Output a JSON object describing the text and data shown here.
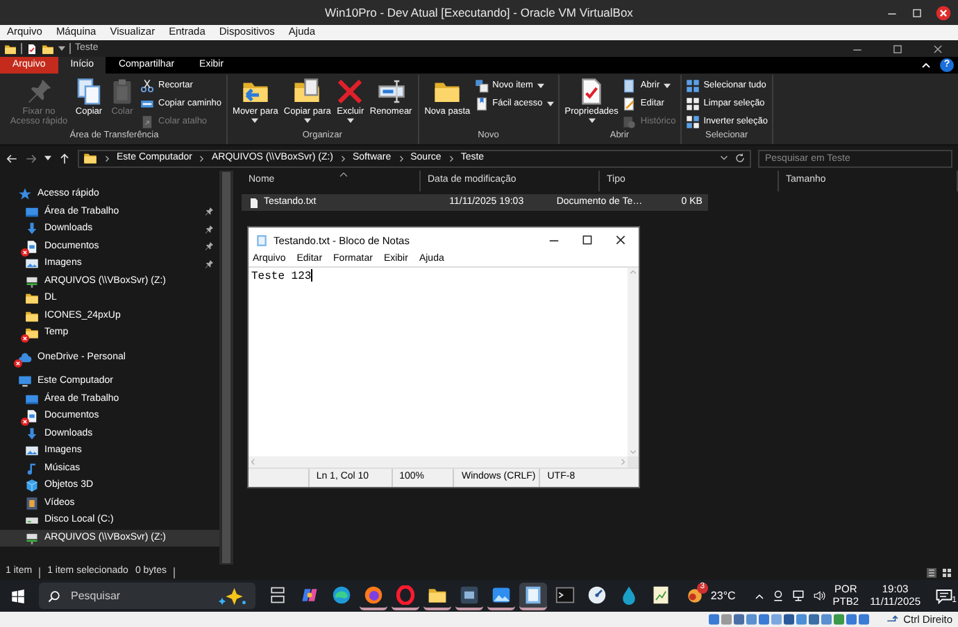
{
  "vbox_window": {
    "title": "Win10Pro - Dev Atual [Executando] - Oracle VM VirtualBox"
  },
  "vbox_menu": [
    "Arquivo",
    "Máquina",
    "Visualizar",
    "Entrada",
    "Dispositivos",
    "Ajuda"
  ],
  "explorer": {
    "title": "Teste",
    "ribbon_tabs": [
      {
        "label": "Arquivo",
        "kind": "file",
        "selected": false
      },
      {
        "label": "Início",
        "kind": "tab",
        "selected": true
      },
      {
        "label": "Compartilhar",
        "kind": "tab",
        "selected": false
      },
      {
        "label": "Exibir",
        "kind": "tab",
        "selected": false
      }
    ],
    "help_button": "?",
    "ribbon_groups": [
      {
        "label": "Área de Transferência",
        "items": [
          {
            "label": "Fixar no Acesso rápido",
            "kind": "large",
            "disabled": true,
            "dropdown": false
          },
          {
            "label": "Copiar",
            "kind": "large",
            "disabled": false,
            "dropdown": false
          },
          {
            "label": "Colar",
            "kind": "large",
            "disabled": true,
            "dropdown": false
          },
          {
            "label": "Recortar",
            "kind": "small",
            "disabled": false,
            "dropdown": false
          },
          {
            "label": "Copiar caminho",
            "kind": "small",
            "disabled": false,
            "dropdown": false
          },
          {
            "label": "Colar atalho",
            "kind": "small",
            "disabled": true,
            "dropdown": false
          }
        ]
      },
      {
        "label": "Organizar",
        "items": [
          {
            "label": "Mover para",
            "kind": "large",
            "disabled": false,
            "dropdown": true
          },
          {
            "label": "Copiar para",
            "kind": "large",
            "disabled": false,
            "dropdown": true
          },
          {
            "label": "Excluir",
            "kind": "large",
            "disabled": false,
            "dropdown": true
          },
          {
            "label": "Renomear",
            "kind": "large",
            "disabled": false,
            "dropdown": false
          }
        ]
      },
      {
        "label": "Novo",
        "items": [
          {
            "label": "Nova pasta",
            "kind": "large",
            "disabled": false,
            "dropdown": false
          },
          {
            "label": "Novo item",
            "kind": "small",
            "disabled": false,
            "dropdown": true
          },
          {
            "label": "Fácil acesso",
            "kind": "small",
            "disabled": false,
            "dropdown": true
          }
        ]
      },
      {
        "label": "Abrir",
        "items": [
          {
            "label": "Propriedades",
            "kind": "large",
            "disabled": false,
            "dropdown": true
          },
          {
            "label": "Abrir",
            "kind": "small",
            "disabled": false,
            "dropdown": true
          },
          {
            "label": "Editar",
            "kind": "small",
            "disabled": false,
            "dropdown": false
          },
          {
            "label": "Histórico",
            "kind": "small",
            "disabled": true,
            "dropdown": false
          }
        ]
      },
      {
        "label": "Selecionar",
        "items": [
          {
            "label": "Selecionar tudo",
            "kind": "small",
            "disabled": false,
            "dropdown": false
          },
          {
            "label": "Limpar seleção",
            "kind": "small",
            "disabled": false,
            "dropdown": false
          },
          {
            "label": "Inverter seleção",
            "kind": "small",
            "disabled": false,
            "dropdown": false
          }
        ]
      }
    ],
    "address_path": [
      "Este Computador",
      "ARQUIVOS (\\\\VBoxSvr) (Z:)",
      "Software",
      "Source",
      "Teste"
    ],
    "search": {
      "placeholder": "Pesquisar em Teste"
    },
    "sidebar": [
      {
        "label": "Acesso rápido",
        "kind": "star",
        "selected": false,
        "sync_error": false,
        "children": [
          {
            "label": "Área de Trabalho",
            "kind": "desktop",
            "selected": false,
            "sync_error": false,
            "pinned": true
          },
          {
            "label": "Downloads",
            "kind": "download",
            "selected": false,
            "sync_error": false,
            "pinned": true
          },
          {
            "label": "Documentos",
            "kind": "documents",
            "selected": false,
            "sync_error": true,
            "pinned": true
          },
          {
            "label": "Imagens",
            "kind": "pictures",
            "selected": false,
            "sync_error": false,
            "pinned": true
          },
          {
            "label": "ARQUIVOS (\\\\VBoxSvr) (Z:)",
            "kind": "netdrive",
            "selected": false,
            "sync_error": false,
            "pinned": false
          },
          {
            "label": "DL",
            "kind": "folder",
            "selected": false,
            "sync_error": false,
            "pinned": false
          },
          {
            "label": "ICONES_24pxUp",
            "kind": "folder",
            "selected": false,
            "sync_error": false,
            "pinned": false
          },
          {
            "label": "Temp",
            "kind": "folder",
            "selected": false,
            "sync_error": true,
            "pinned": false
          }
        ]
      },
      {
        "label": "OneDrive - Personal",
        "kind": "cloud",
        "selected": false,
        "sync_error": true
      },
      {
        "label": "Este Computador",
        "kind": "computer",
        "selected": false,
        "sync_error": false,
        "children": [
          {
            "label": "Área de Trabalho",
            "kind": "desktop",
            "selected": false,
            "sync_error": false
          },
          {
            "label": "Documentos",
            "kind": "documents",
            "selected": false,
            "sync_error": true
          },
          {
            "label": "Downloads",
            "kind": "download",
            "selected": false,
            "sync_error": false
          },
          {
            "label": "Imagens",
            "kind": "pictures",
            "selected": false,
            "sync_error": false
          },
          {
            "label": "Músicas",
            "kind": "music",
            "selected": false,
            "sync_error": false
          },
          {
            "label": "Objetos 3D",
            "kind": "objects3d",
            "selected": false,
            "sync_error": false
          },
          {
            "label": "Vídeos",
            "kind": "videos",
            "selected": false,
            "sync_error": false
          },
          {
            "label": "Disco Local (C:)",
            "kind": "disk",
            "selected": false,
            "sync_error": false
          },
          {
            "label": "ARQUIVOS (\\\\VBoxSvr) (Z:)",
            "kind": "netdrive",
            "selected": true,
            "sync_error": false
          }
        ]
      }
    ],
    "file_table": {
      "columns": [
        "Nome",
        "Data de modificação",
        "Tipo",
        "Tamanho"
      ],
      "rows": [
        {
          "cells": [
            "Testando.txt",
            "11/11/2025 19:03",
            "Documento de Te…",
            "0 KB"
          ],
          "selected": true
        }
      ]
    },
    "status_bar": [
      "1 item",
      "1 item selecionado",
      "0 bytes"
    ]
  },
  "notepad": {
    "title": "Testando.txt - Bloco de Notas",
    "menu": [
      "Arquivo",
      "Editar",
      "Formatar",
      "Exibir",
      "Ajuda"
    ],
    "content": "Teste 123",
    "status_bar": [
      "Ln 1, Col 10",
      "100%",
      "Windows (CRLF)",
      "UTF-8"
    ]
  },
  "taskbar": {
    "search_placeholder": "Pesquisar",
    "apps": [
      {
        "kind": "taskview",
        "running": false,
        "selected": false
      },
      {
        "kind": "copilot",
        "running": false,
        "selected": false
      },
      {
        "kind": "edge",
        "running": false,
        "selected": false
      },
      {
        "kind": "firefox",
        "running": true,
        "selected": false
      },
      {
        "kind": "opera",
        "running": true,
        "selected": false
      },
      {
        "kind": "explorer",
        "running": true,
        "selected": false
      },
      {
        "kind": "remote",
        "running": true,
        "selected": false
      },
      {
        "kind": "photos",
        "running": true,
        "selected": false
      },
      {
        "kind": "notepad",
        "running": true,
        "selected": true
      },
      {
        "kind": "terminal",
        "running": false,
        "selected": false
      },
      {
        "kind": "gauge",
        "running": false,
        "selected": false
      },
      {
        "kind": "drop",
        "running": false,
        "selected": false
      },
      {
        "kind": "chartnote",
        "running": false,
        "selected": false
      }
    ],
    "weather_badge": "3",
    "temperature": "23°C",
    "language": [
      "POR",
      "PTB2"
    ],
    "time": "19:03",
    "date": "11/11/2025",
    "notification_count": "1"
  },
  "vbox_status": {
    "host_key": "Ctrl Direito"
  }
}
